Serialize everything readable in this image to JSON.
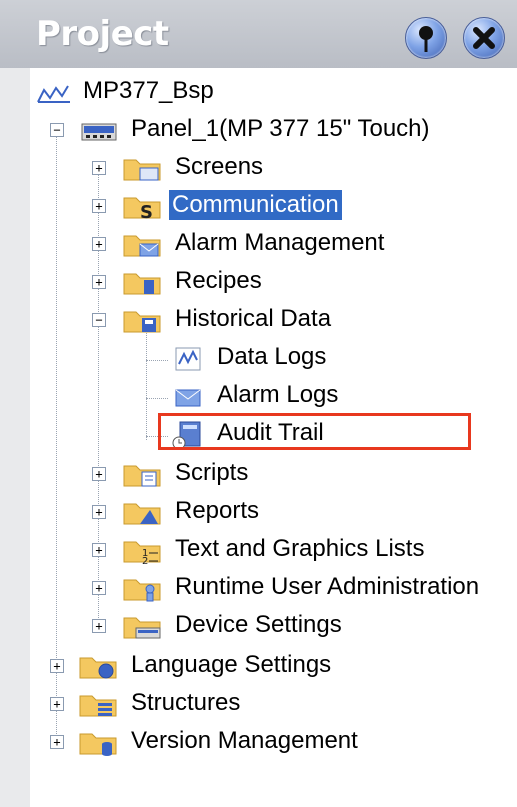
{
  "panel": {
    "title": "Project"
  },
  "tree": {
    "project": "MP377_Bsp",
    "device": "Panel_1(MP 377 15\" Touch)",
    "device_children": [
      "Screens",
      "Communication",
      "Alarm Management",
      "Recipes",
      "Historical Data"
    ],
    "historical_children": [
      "Data Logs",
      "Alarm Logs",
      "Audit Trail"
    ],
    "device_children_after": [
      "Scripts",
      "Reports",
      "Text and Graphics Lists",
      "Runtime User Administration",
      "Device Settings"
    ],
    "root_children": [
      "Language Settings",
      "Structures",
      "Version Management"
    ],
    "selected": "Communication",
    "highlighted": "Audit Trail"
  },
  "colors": {
    "selection": "#316ac5",
    "highlight_box": "#e8381e",
    "folder": "#f4c860"
  }
}
